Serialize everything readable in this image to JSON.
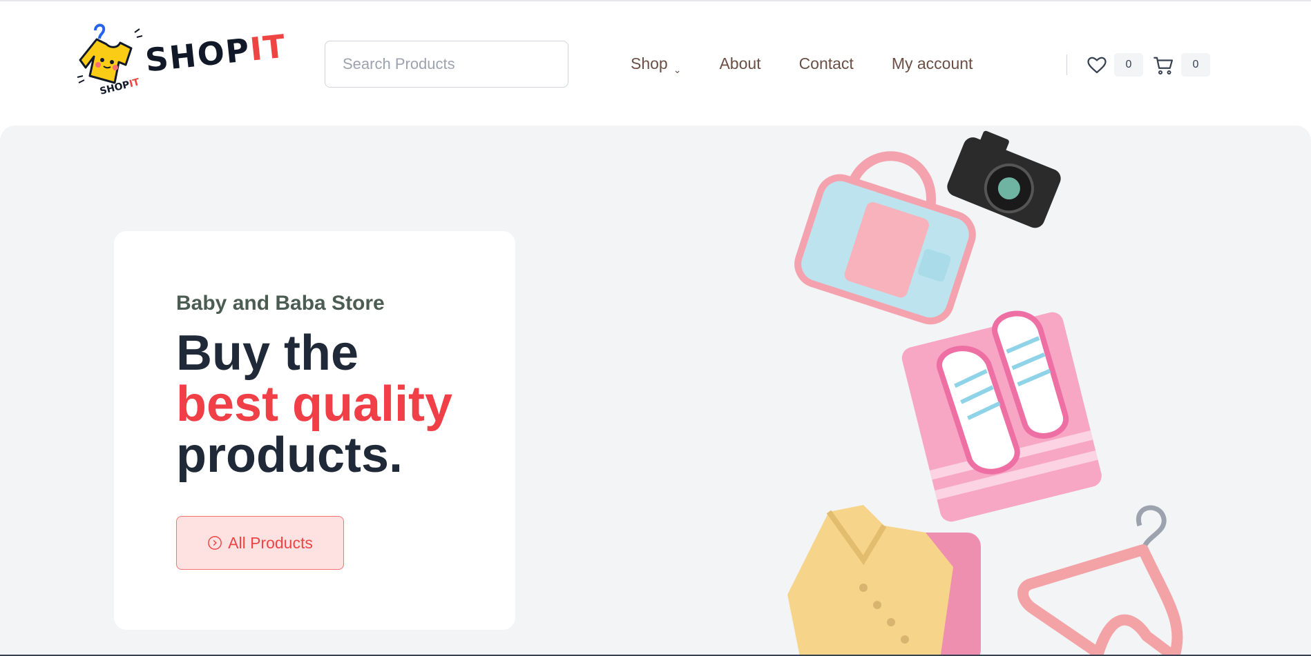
{
  "brand": {
    "logo_main_a": "SHOP",
    "logo_main_b": "IT",
    "logo_sub_a": "SHOP",
    "logo_sub_b": "IT",
    "accent": "#ef4444"
  },
  "search": {
    "placeholder": "Search Products",
    "value": ""
  },
  "nav": {
    "items": [
      {
        "label": "Shop",
        "has_dropdown": true
      },
      {
        "label": "About"
      },
      {
        "label": "Contact"
      },
      {
        "label": "My account"
      }
    ]
  },
  "header_actions": {
    "wishlist_icon": "heart-icon",
    "wishlist_count": "0",
    "cart_icon": "cart-icon",
    "cart_count": "0"
  },
  "hero": {
    "eyebrow": "Baby and Baba Store",
    "headline_line1": "Buy the",
    "headline_highlight": "best quality",
    "headline_line3": "products.",
    "cta_label": "All Products",
    "cta_icon": "chevron-right-circle-icon",
    "background": "#f3f4f6",
    "highlight_color": "#f13f47"
  }
}
